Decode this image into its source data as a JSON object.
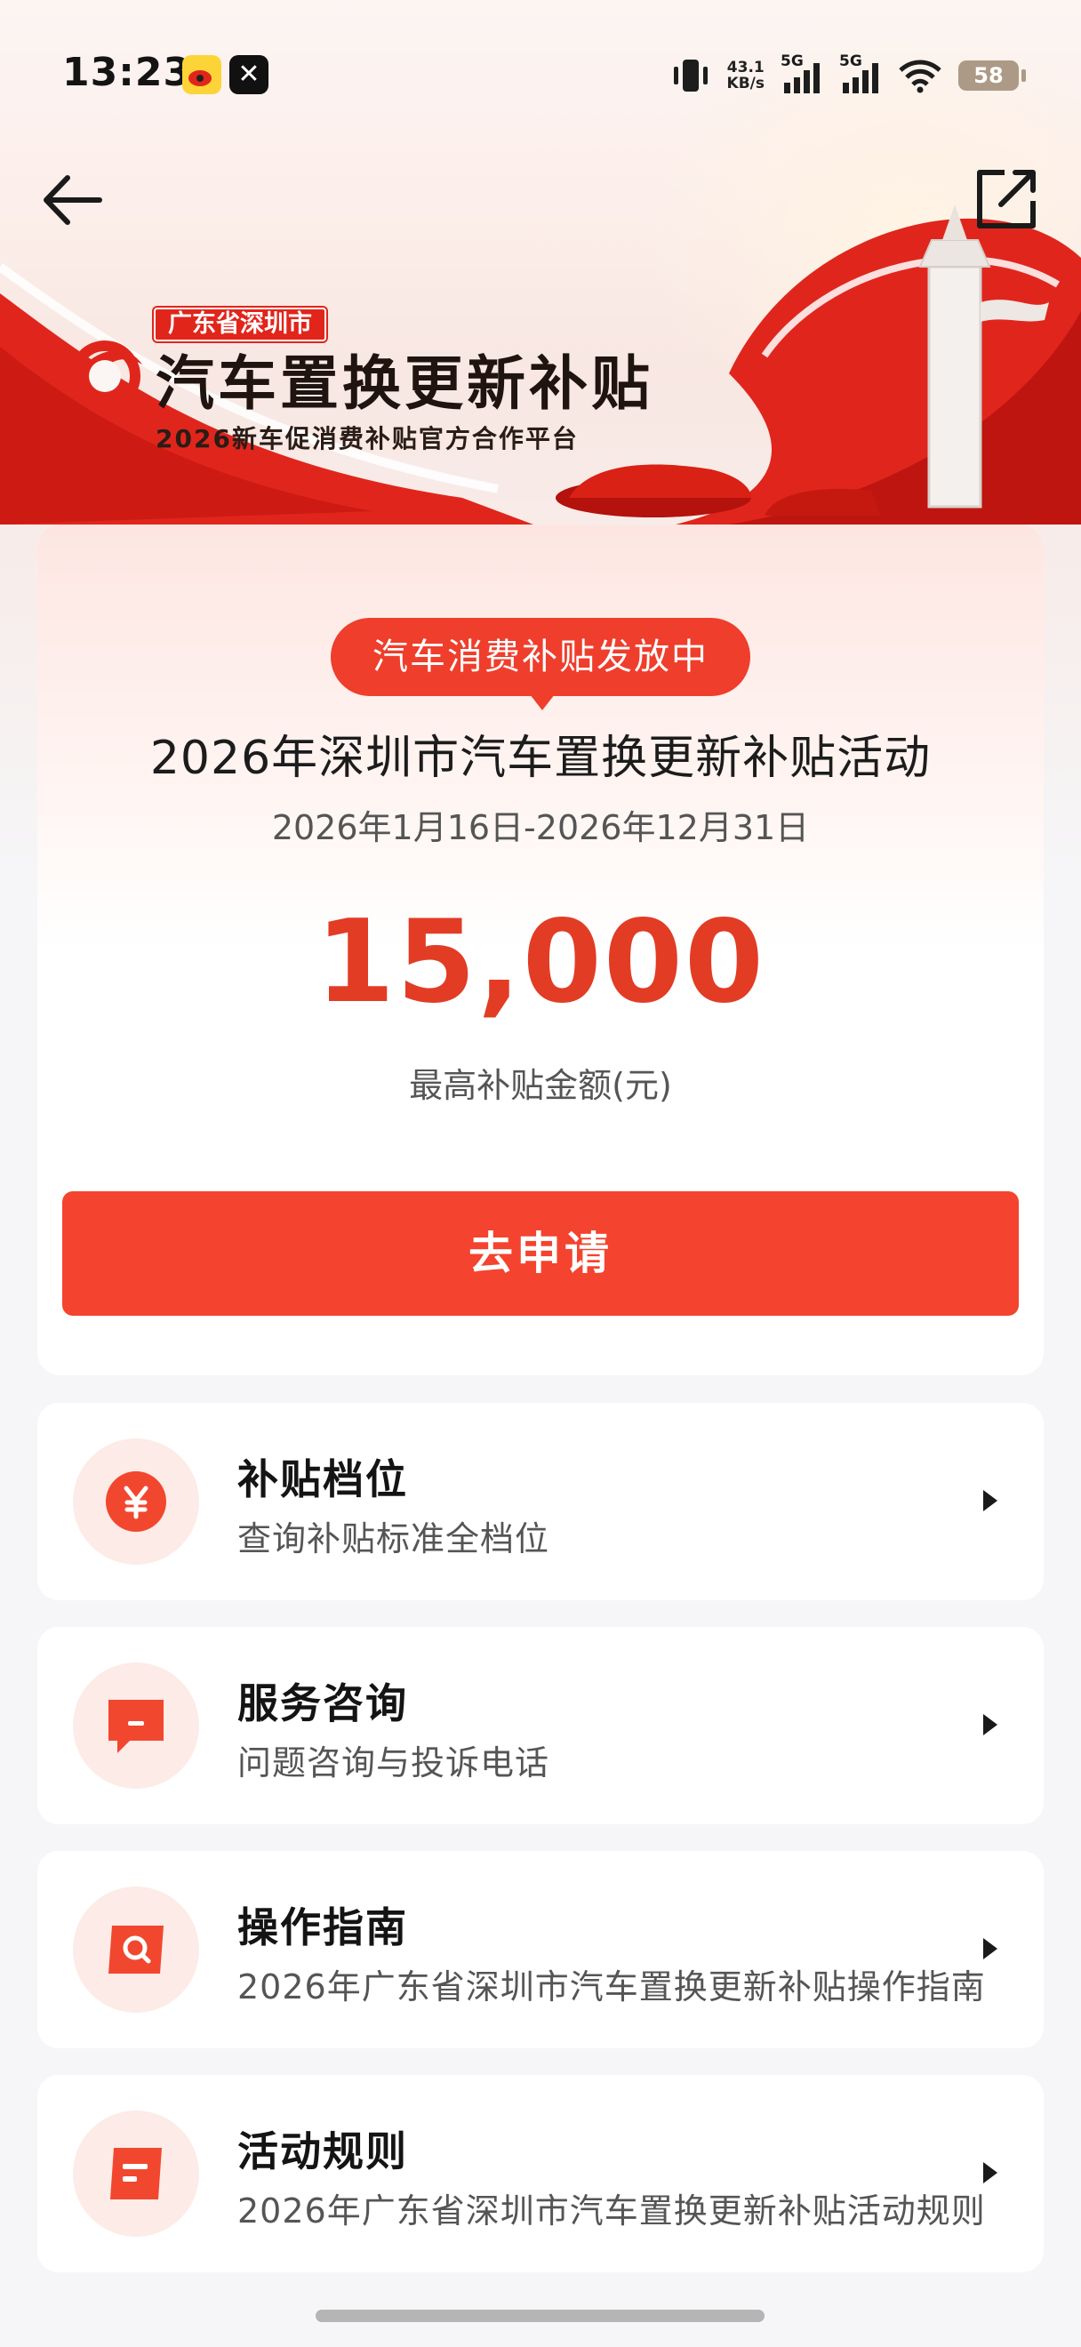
{
  "status_bar": {
    "time": "13:23",
    "x_app_glyph": "✕",
    "network_speed_value": "43.1",
    "network_speed_unit": "KB/s",
    "signal_1_label": "5G",
    "signal_2_label": "5G",
    "battery": "58"
  },
  "hero": {
    "location_tag": "广东省深圳市",
    "title": "汽车置换更新补贴",
    "subtitle": "2026新车促消费补贴官方合作平台"
  },
  "main_card": {
    "status_pill": "汽车消费补贴发放中",
    "activity_title": "2026年深圳市汽车置换更新补贴活动",
    "activity_dates": "2026年1月16日-2026年12月31日",
    "amount": "15,000",
    "amount_label": "最高补贴金额(元)",
    "apply_button": "去申请"
  },
  "menu": [
    {
      "title": "补贴档位",
      "subtitle": "查询补贴标准全档位",
      "icon": "yen-icon"
    },
    {
      "title": "服务咨询",
      "subtitle": "问题咨询与投诉电话",
      "icon": "chat-icon"
    },
    {
      "title": "操作指南",
      "subtitle": "2026年广东省深圳市汽车置换更新补贴操作指南",
      "icon": "search-doc-icon"
    },
    {
      "title": "活动规则",
      "subtitle": "2026年广东省深圳市汽车置换更新补贴活动规则",
      "icon": "rules-doc-icon"
    }
  ],
  "colors": {
    "accent": "#f4432e",
    "amount": "#e23c25",
    "icon_bg": "#fdebe7"
  }
}
